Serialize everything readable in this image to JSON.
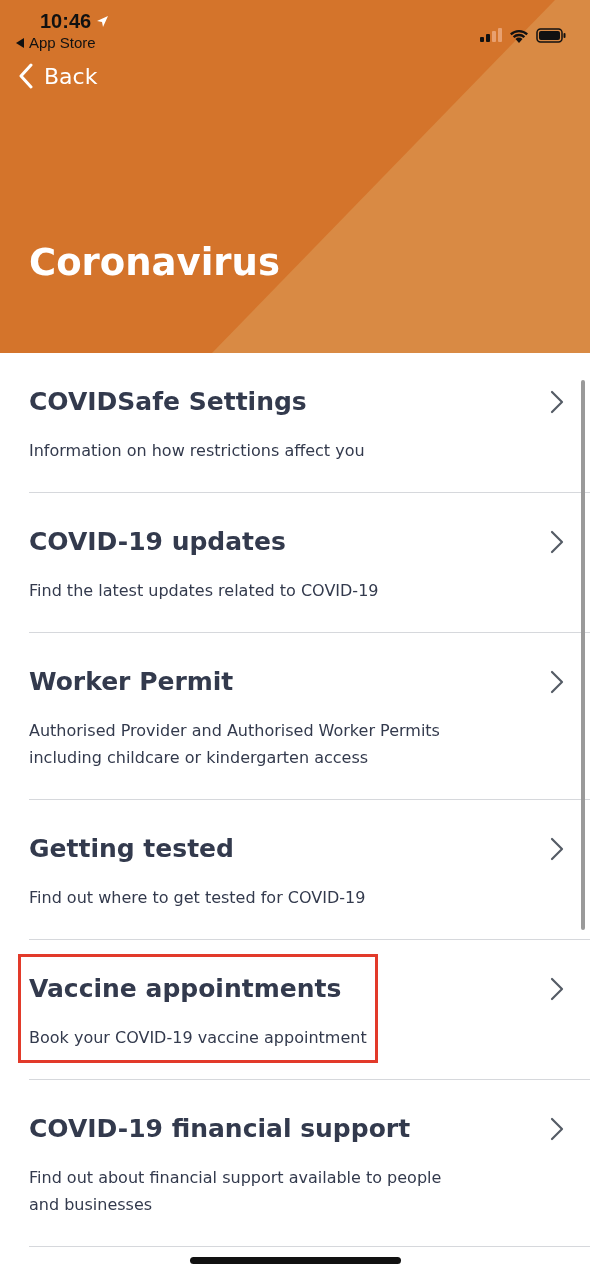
{
  "status_bar": {
    "time": "10:46",
    "back_app": "App Store"
  },
  "back": "Back",
  "title": "Coronavirus",
  "items": [
    {
      "title": "COVIDSafe Settings",
      "subtitle": "Information on how restrictions affect you",
      "highlighted": false
    },
    {
      "title": "COVID-19 updates",
      "subtitle": "Find the latest updates related to COVID-19",
      "highlighted": false
    },
    {
      "title": "Worker Permit",
      "subtitle": "Authorised Provider and Authorised Worker Permits including childcare or kindergarten access",
      "highlighted": false
    },
    {
      "title": "Getting tested",
      "subtitle": "Find out where to get tested for COVID-19",
      "highlighted": false
    },
    {
      "title": "Vaccine appointments",
      "subtitle": "Book your COVID-19 vaccine appointment",
      "highlighted": true
    },
    {
      "title": "COVID-19 financial support",
      "subtitle": "Find out about financial support available to people and businesses",
      "highlighted": false
    }
  ]
}
